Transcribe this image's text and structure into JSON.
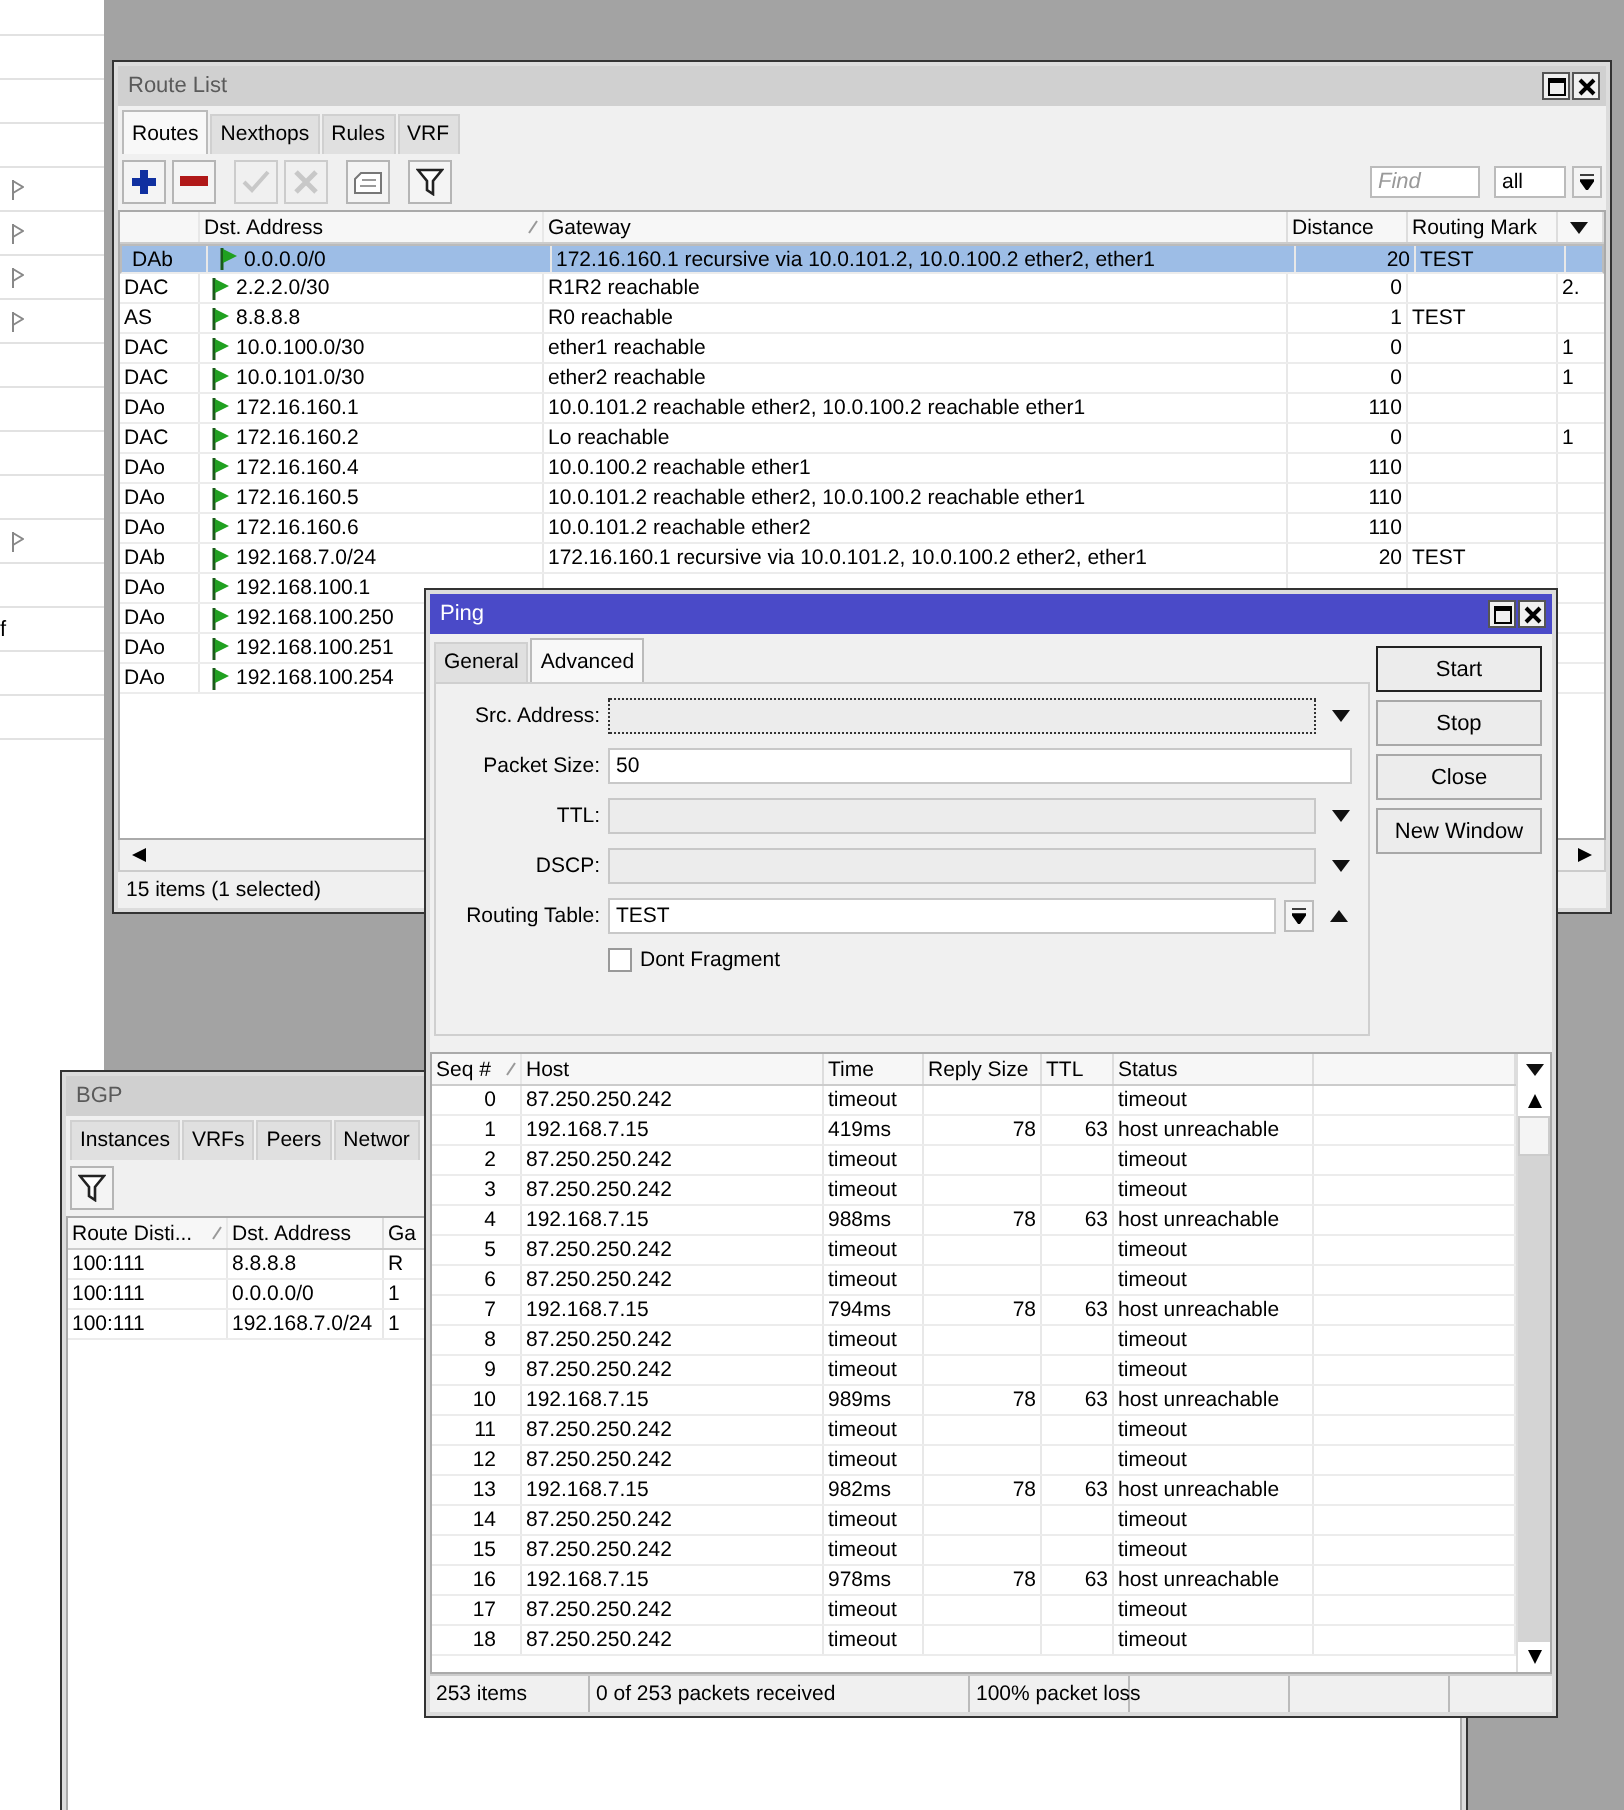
{
  "left_panel": {
    "rows": [
      {
        "kind": "blank"
      },
      {
        "kind": "blank"
      },
      {
        "kind": "blank"
      },
      {
        "kind": "blank"
      },
      {
        "kind": "flag"
      },
      {
        "kind": "flag"
      },
      {
        "kind": "flag"
      },
      {
        "kind": "flag"
      },
      {
        "kind": "blank"
      },
      {
        "kind": "blank"
      },
      {
        "kind": "blank"
      },
      {
        "kind": "blank"
      },
      {
        "kind": "flag"
      },
      {
        "kind": "blank"
      },
      {
        "kind": "text",
        "text": "f"
      },
      {
        "kind": "blank"
      },
      {
        "kind": "blank"
      }
    ]
  },
  "route_list": {
    "title": "Route List",
    "tabs": [
      {
        "label": "Routes",
        "selected": true
      },
      {
        "label": "Nexthops",
        "selected": false
      },
      {
        "label": "Rules",
        "selected": false
      },
      {
        "label": "VRF",
        "selected": false
      }
    ],
    "toolbar": [
      {
        "kind": "add",
        "disabled": false
      },
      {
        "kind": "remove",
        "disabled": false
      },
      {
        "kind": "enable",
        "disabled": true
      },
      {
        "kind": "disable",
        "disabled": true
      },
      {
        "kind": "comment",
        "disabled": false
      },
      {
        "kind": "filter",
        "disabled": false
      }
    ],
    "find": {
      "placeholder": "Find"
    },
    "filter_select": {
      "value": "all"
    },
    "columns": [
      "",
      "Dst. Address",
      "Gateway",
      "Distance",
      "Routing Mark",
      ""
    ],
    "rows": [
      {
        "flags": "DAb",
        "dst": "0.0.0.0/0",
        "gateway": "172.16.160.1 recursive via 10.0.101.2, 10.0.100.2 ether2, ether1",
        "distance": "20",
        "mark": "TEST",
        "selected": true
      },
      {
        "flags": "DAC",
        "dst": "2.2.2.0/30",
        "gateway": "R1R2 reachable",
        "distance": "0",
        "column_6": "2.",
        "selected": false
      },
      {
        "flags": "AS",
        "dst": "8.8.8.8",
        "gateway": "R0 reachable",
        "distance": "1",
        "mark": "TEST",
        "selected": false
      },
      {
        "flags": "DAC",
        "dst": "10.0.100.0/30",
        "gateway": "ether1 reachable",
        "distance": "0",
        "column_6": "1",
        "selected": false
      },
      {
        "flags": "DAC",
        "dst": "10.0.101.0/30",
        "gateway": "ether2 reachable",
        "distance": "0",
        "column_6": "1",
        "selected": false
      },
      {
        "flags": "DAo",
        "dst": "172.16.160.1",
        "gateway": "10.0.101.2 reachable ether2, 10.0.100.2 reachable ether1",
        "distance": "110",
        "selected": false
      },
      {
        "flags": "DAC",
        "dst": "172.16.160.2",
        "gateway": "Lo reachable",
        "distance": "0",
        "column_6": "1",
        "selected": false
      },
      {
        "flags": "DAo",
        "dst": "172.16.160.4",
        "gateway": "10.0.100.2 reachable ether1",
        "distance": "110",
        "selected": false
      },
      {
        "flags": "DAo",
        "dst": "172.16.160.5",
        "gateway": "10.0.101.2 reachable ether2, 10.0.100.2 reachable ether1",
        "distance": "110",
        "selected": false
      },
      {
        "flags": "DAo",
        "dst": "172.16.160.6",
        "gateway": "10.0.101.2 reachable ether2",
        "distance": "110",
        "selected": false
      },
      {
        "flags": "DAb",
        "dst": "192.168.7.0/24",
        "gateway": "172.16.160.1 recursive via 10.0.101.2, 10.0.100.2 ether2, ether1",
        "distance": "20",
        "mark": "TEST",
        "selected": false
      },
      {
        "flags": "DAo",
        "dst": "192.168.100.1",
        "selected": false
      },
      {
        "flags": "DAo",
        "dst": "192.168.100.250",
        "selected": false
      },
      {
        "flags": "DAo",
        "dst": "192.168.100.251",
        "selected": false
      },
      {
        "flags": "DAo",
        "dst": "192.168.100.254",
        "selected": false
      }
    ],
    "status": "15 items (1 selected)"
  },
  "bgp": {
    "title": "BGP",
    "tabs": [
      {
        "label": "Instances",
        "selected": false
      },
      {
        "label": "VRFs",
        "selected": false
      },
      {
        "label": "Peers",
        "selected": false
      },
      {
        "label": "Networ",
        "selected": false
      }
    ],
    "columns": [
      "Route Disti...",
      "Dst. Address",
      "Ga"
    ],
    "rows": [
      {
        "rd": "100:111",
        "dst": "8.8.8.8",
        "column_3": "R"
      },
      {
        "rd": "100:111",
        "dst": "0.0.0.0/0",
        "column_3": "1"
      },
      {
        "rd": "100:111",
        "dst": "192.168.7.0/24",
        "column_3": "1"
      }
    ]
  },
  "ping": {
    "title": "Ping",
    "tabs": [
      {
        "label": "General",
        "selected": false
      },
      {
        "label": "Advanced",
        "selected": true
      }
    ],
    "fields": [
      {
        "label": "Src. Address:",
        "kind": "combo",
        "focused": true
      },
      {
        "label": "Packet Size:",
        "kind": "text",
        "value": "50",
        "focused": false
      },
      {
        "label": "TTL:",
        "kind": "combo",
        "focused": false
      },
      {
        "label": "DSCP:",
        "kind": "combo",
        "focused": false
      },
      {
        "label": "Routing Table:",
        "kind": "select",
        "value": "TEST",
        "focused": false
      }
    ],
    "dont_fragment": {
      "label": "Dont Fragment",
      "checked": false
    },
    "buttons": [
      {
        "label": "Start",
        "default": true
      },
      {
        "label": "Stop",
        "default": false
      },
      {
        "label": "Close",
        "default": false
      },
      {
        "label": "New Window",
        "default": false
      }
    ],
    "columns": [
      "Seq #",
      "Host",
      "Time",
      "Reply Size",
      "TTL",
      "Status",
      ""
    ],
    "rows": [
      {
        "seq": "0",
        "host": "87.250.250.242",
        "time": "timeout",
        "status": "timeout"
      },
      {
        "seq": "1",
        "host": "192.168.7.15",
        "time": "419ms",
        "reply_size": "78",
        "ttl": "63",
        "status": "host unreachable"
      },
      {
        "seq": "2",
        "host": "87.250.250.242",
        "time": "timeout",
        "status": "timeout"
      },
      {
        "seq": "3",
        "host": "87.250.250.242",
        "time": "timeout",
        "status": "timeout"
      },
      {
        "seq": "4",
        "host": "192.168.7.15",
        "time": "988ms",
        "reply_size": "78",
        "ttl": "63",
        "status": "host unreachable"
      },
      {
        "seq": "5",
        "host": "87.250.250.242",
        "time": "timeout",
        "status": "timeout"
      },
      {
        "seq": "6",
        "host": "87.250.250.242",
        "time": "timeout",
        "status": "timeout"
      },
      {
        "seq": "7",
        "host": "192.168.7.15",
        "time": "794ms",
        "reply_size": "78",
        "ttl": "63",
        "status": "host unreachable"
      },
      {
        "seq": "8",
        "host": "87.250.250.242",
        "time": "timeout",
        "status": "timeout"
      },
      {
        "seq": "9",
        "host": "87.250.250.242",
        "time": "timeout",
        "status": "timeout"
      },
      {
        "seq": "10",
        "host": "192.168.7.15",
        "time": "989ms",
        "reply_size": "78",
        "ttl": "63",
        "status": "host unreachable"
      },
      {
        "seq": "11",
        "host": "87.250.250.242",
        "time": "timeout",
        "status": "timeout"
      },
      {
        "seq": "12",
        "host": "87.250.250.242",
        "time": "timeout",
        "status": "timeout"
      },
      {
        "seq": "13",
        "host": "192.168.7.15",
        "time": "982ms",
        "reply_size": "78",
        "ttl": "63",
        "status": "host unreachable"
      },
      {
        "seq": "14",
        "host": "87.250.250.242",
        "time": "timeout",
        "status": "timeout"
      },
      {
        "seq": "15",
        "host": "87.250.250.242",
        "time": "timeout",
        "status": "timeout"
      },
      {
        "seq": "16",
        "host": "192.168.7.15",
        "time": "978ms",
        "reply_size": "78",
        "ttl": "63",
        "status": "host unreachable"
      },
      {
        "seq": "17",
        "host": "87.250.250.242",
        "time": "timeout",
        "status": "timeout"
      },
      {
        "seq": "18",
        "host": "87.250.250.242",
        "time": "timeout",
        "status": "timeout"
      }
    ],
    "status": [
      "253 items",
      "0 of 253 packets received",
      "100% packet loss"
    ]
  }
}
